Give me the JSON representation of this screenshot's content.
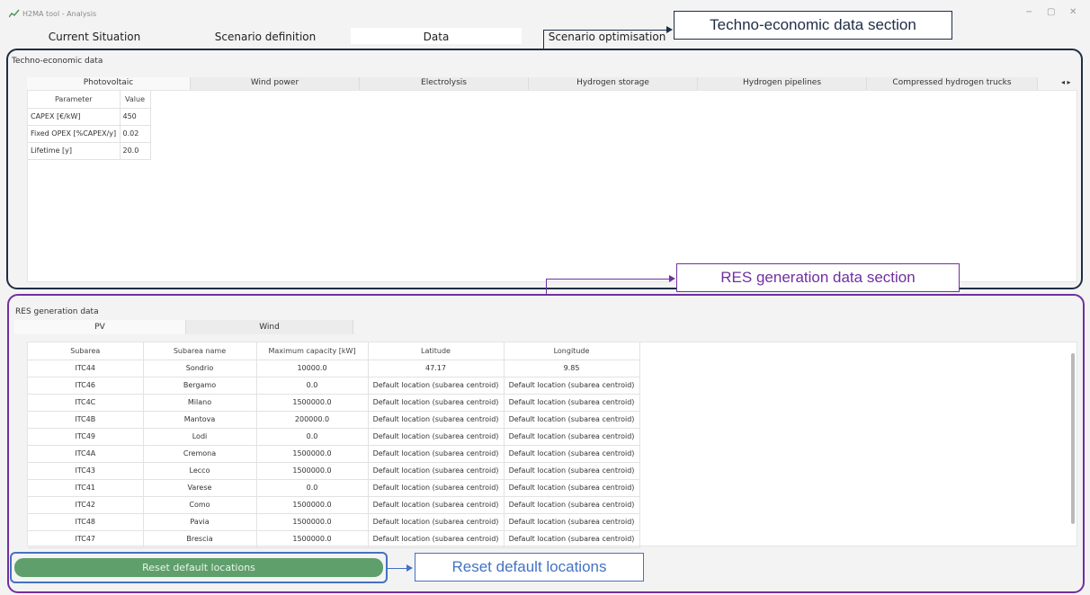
{
  "window": {
    "title": "H2MA tool - Analysis",
    "controls": {
      "minimize": "−",
      "maximize": "▢",
      "close": "✕"
    }
  },
  "main_tabs": [
    {
      "label": "Current Situation"
    },
    {
      "label": "Scenario definition"
    },
    {
      "label": "Data",
      "active": true
    },
    {
      "label": "Scenario optimisation"
    }
  ],
  "techno": {
    "section_label": "Techno-economic data",
    "tabs": [
      {
        "label": "Photovoltaic",
        "active": true
      },
      {
        "label": "Wind power"
      },
      {
        "label": "Electrolysis"
      },
      {
        "label": "Hydrogen storage"
      },
      {
        "label": "Hydrogen pipelines"
      },
      {
        "label": "Compressed hydrogen trucks"
      }
    ],
    "scroll_arrows": "◂ ▸",
    "table": {
      "headers": [
        "Parameter",
        "Value"
      ],
      "rows": [
        [
          "CAPEX [€/kW]",
          "450"
        ],
        [
          "Fixed OPEX [%CAPEX/y]",
          "0.02"
        ],
        [
          "Lifetime [y]",
          "20.0"
        ]
      ]
    }
  },
  "res": {
    "section_label": "RES generation data",
    "tabs": [
      {
        "label": "PV",
        "active": true
      },
      {
        "label": "Wind"
      }
    ],
    "table": {
      "headers": [
        "Subarea",
        "Subarea name",
        "Maximum capacity [kW]",
        "Latitude",
        "Longitude"
      ],
      "rows": [
        [
          "ITC44",
          "Sondrio",
          "10000.0",
          "47.17",
          "9.85"
        ],
        [
          "ITC46",
          "Bergamo",
          "0.0",
          "Default location (subarea centroid)",
          "Default location (subarea centroid)"
        ],
        [
          "ITC4C",
          "Milano",
          "1500000.0",
          "Default location (subarea centroid)",
          "Default location (subarea centroid)"
        ],
        [
          "ITC4B",
          "Mantova",
          "200000.0",
          "Default location (subarea centroid)",
          "Default location (subarea centroid)"
        ],
        [
          "ITC49",
          "Lodi",
          "0.0",
          "Default location (subarea centroid)",
          "Default location (subarea centroid)"
        ],
        [
          "ITC4A",
          "Cremona",
          "1500000.0",
          "Default location (subarea centroid)",
          "Default location (subarea centroid)"
        ],
        [
          "ITC43",
          "Lecco",
          "1500000.0",
          "Default location (subarea centroid)",
          "Default location (subarea centroid)"
        ],
        [
          "ITC41",
          "Varese",
          "0.0",
          "Default location (subarea centroid)",
          "Default location (subarea centroid)"
        ],
        [
          "ITC42",
          "Como",
          "1500000.0",
          "Default location (subarea centroid)",
          "Default location (subarea centroid)"
        ],
        [
          "ITC48",
          "Pavia",
          "1500000.0",
          "Default location (subarea centroid)",
          "Default location (subarea centroid)"
        ],
        [
          "ITC47",
          "Brescia",
          "1500000.0",
          "Default location (subarea centroid)",
          "Default location (subarea centroid)"
        ]
      ]
    }
  },
  "reset_button": {
    "label": "Reset default locations"
  },
  "annotations": {
    "techno": {
      "text": "Techno-economic data section",
      "color": "#1f2d45"
    },
    "res": {
      "text": "RES generation data section",
      "color": "#7030a0"
    },
    "reset": {
      "text": "Reset default locations",
      "color": "#4472c4"
    }
  }
}
